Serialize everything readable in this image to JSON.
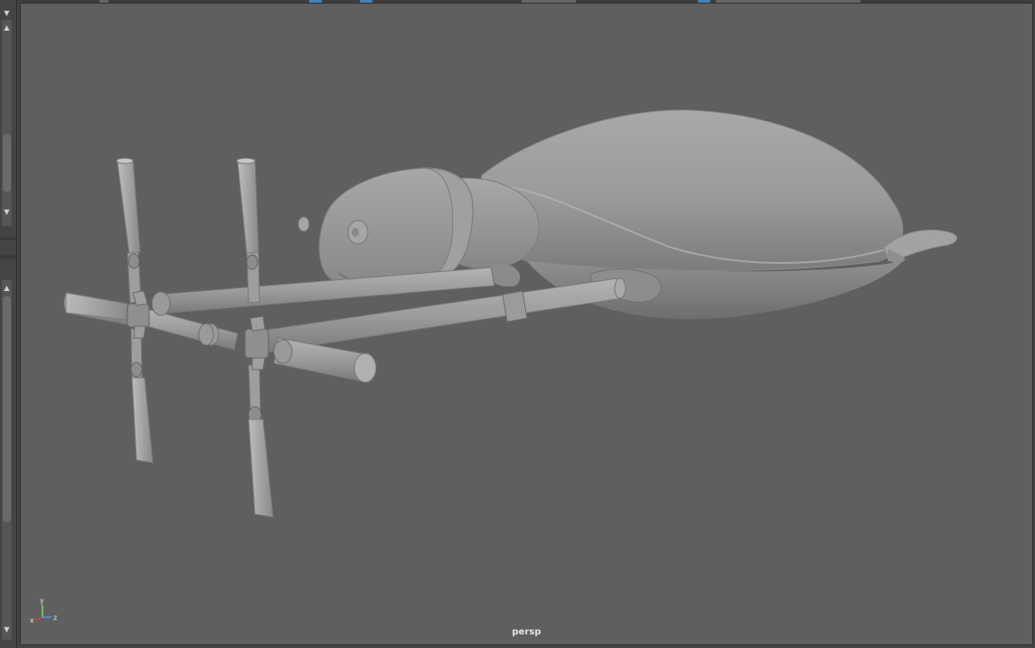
{
  "viewport": {
    "camera_label": "persp",
    "axis_labels": {
      "x": "x",
      "y": "y",
      "z": "z"
    }
  },
  "colors": {
    "viewport_bg": "#5f5f5f",
    "axis_x": "#d94040",
    "axis_y": "#7ed957",
    "axis_z": "#5b8fe8"
  }
}
